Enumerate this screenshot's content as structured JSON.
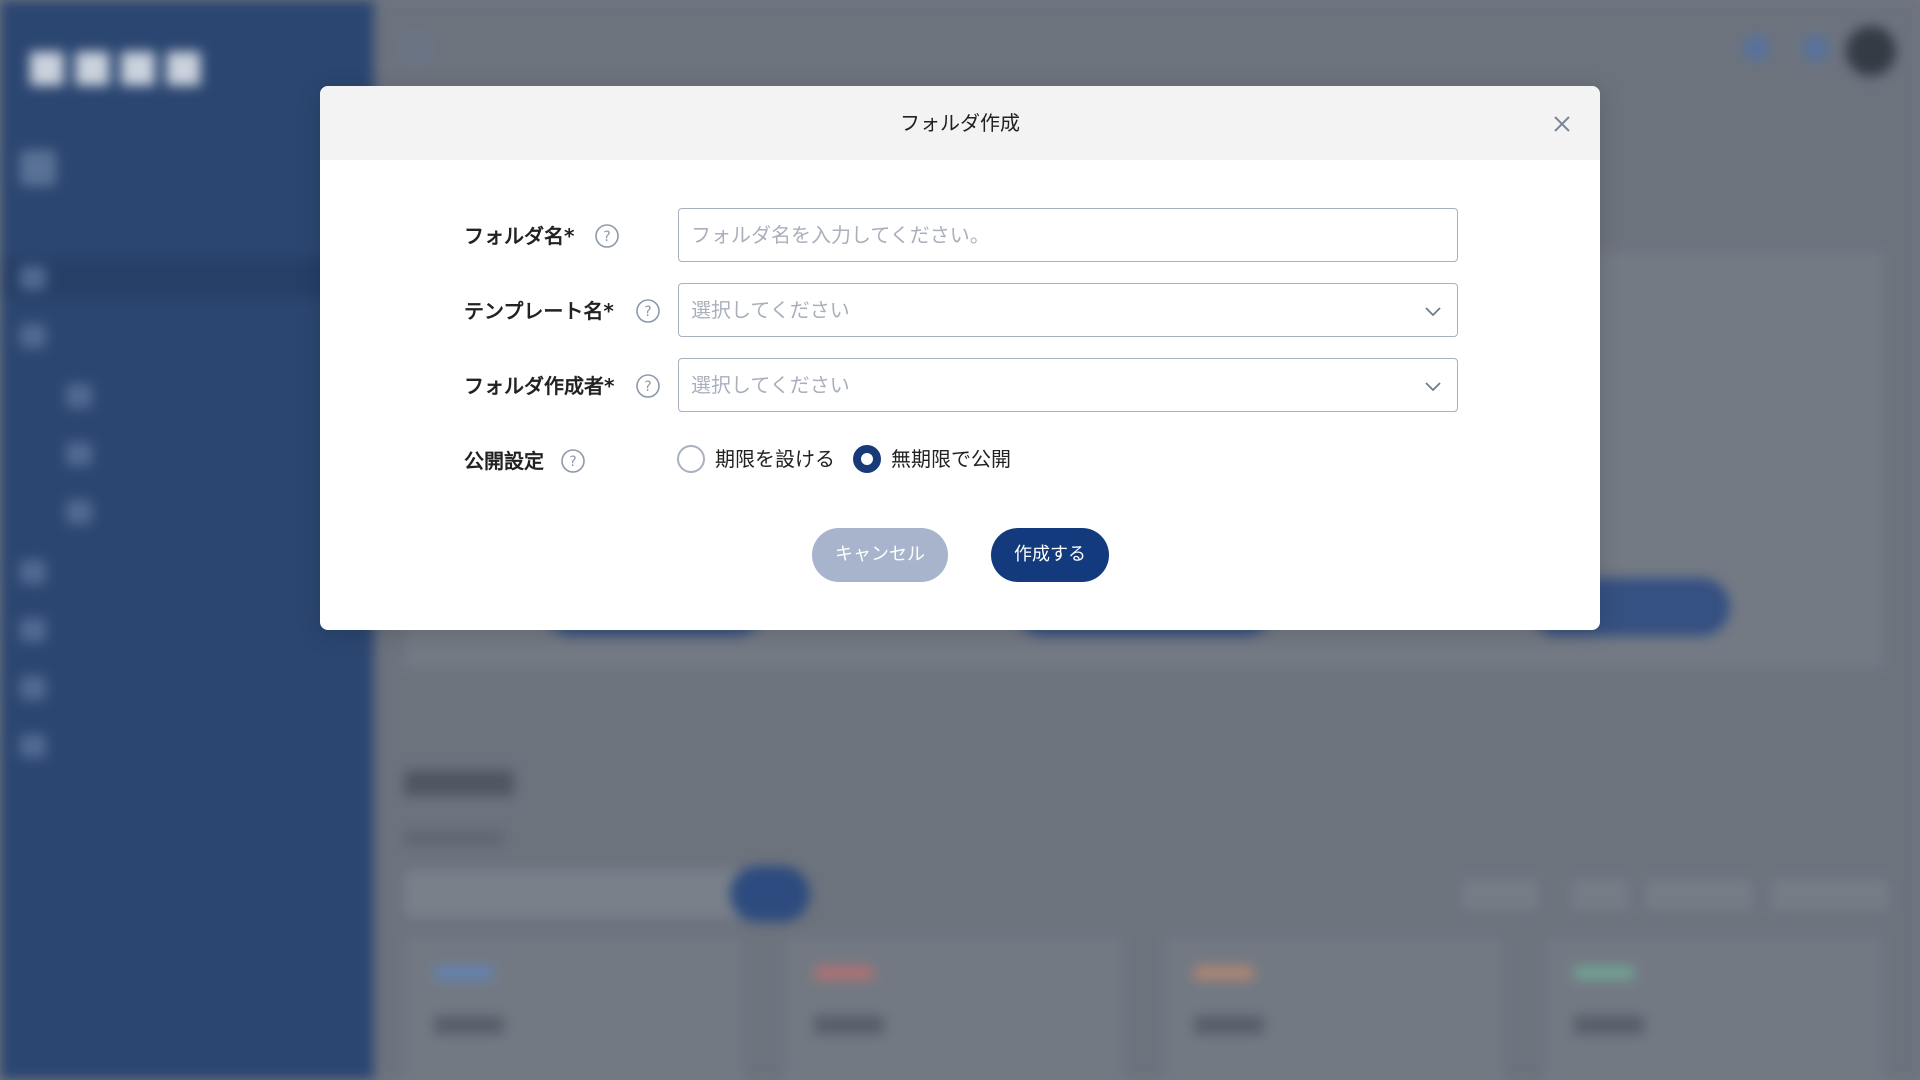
{
  "modal": {
    "title": "フォルダ作成",
    "close_icon": "close-icon",
    "fields": {
      "folder_name": {
        "label": "フォルダ名*",
        "value": "",
        "placeholder": "フォルダ名を入力してください。"
      },
      "template_name": {
        "label": "テンプレート名*",
        "selected": "選択してください"
      },
      "folder_creator": {
        "label": "フォルダ作成者*",
        "selected": "選択してください"
      },
      "visibility": {
        "label": "公開設定",
        "options": [
          {
            "label": "期限を設ける",
            "selected": false
          },
          {
            "label": "無期限で公開",
            "selected": true
          }
        ]
      }
    },
    "buttons": {
      "cancel": "キャンセル",
      "create": "作成する"
    }
  },
  "colors": {
    "primary": "#123a7c",
    "cancel": "#a8b4cb",
    "sidebar": "#2a4777",
    "backdrop": "#747a85"
  }
}
